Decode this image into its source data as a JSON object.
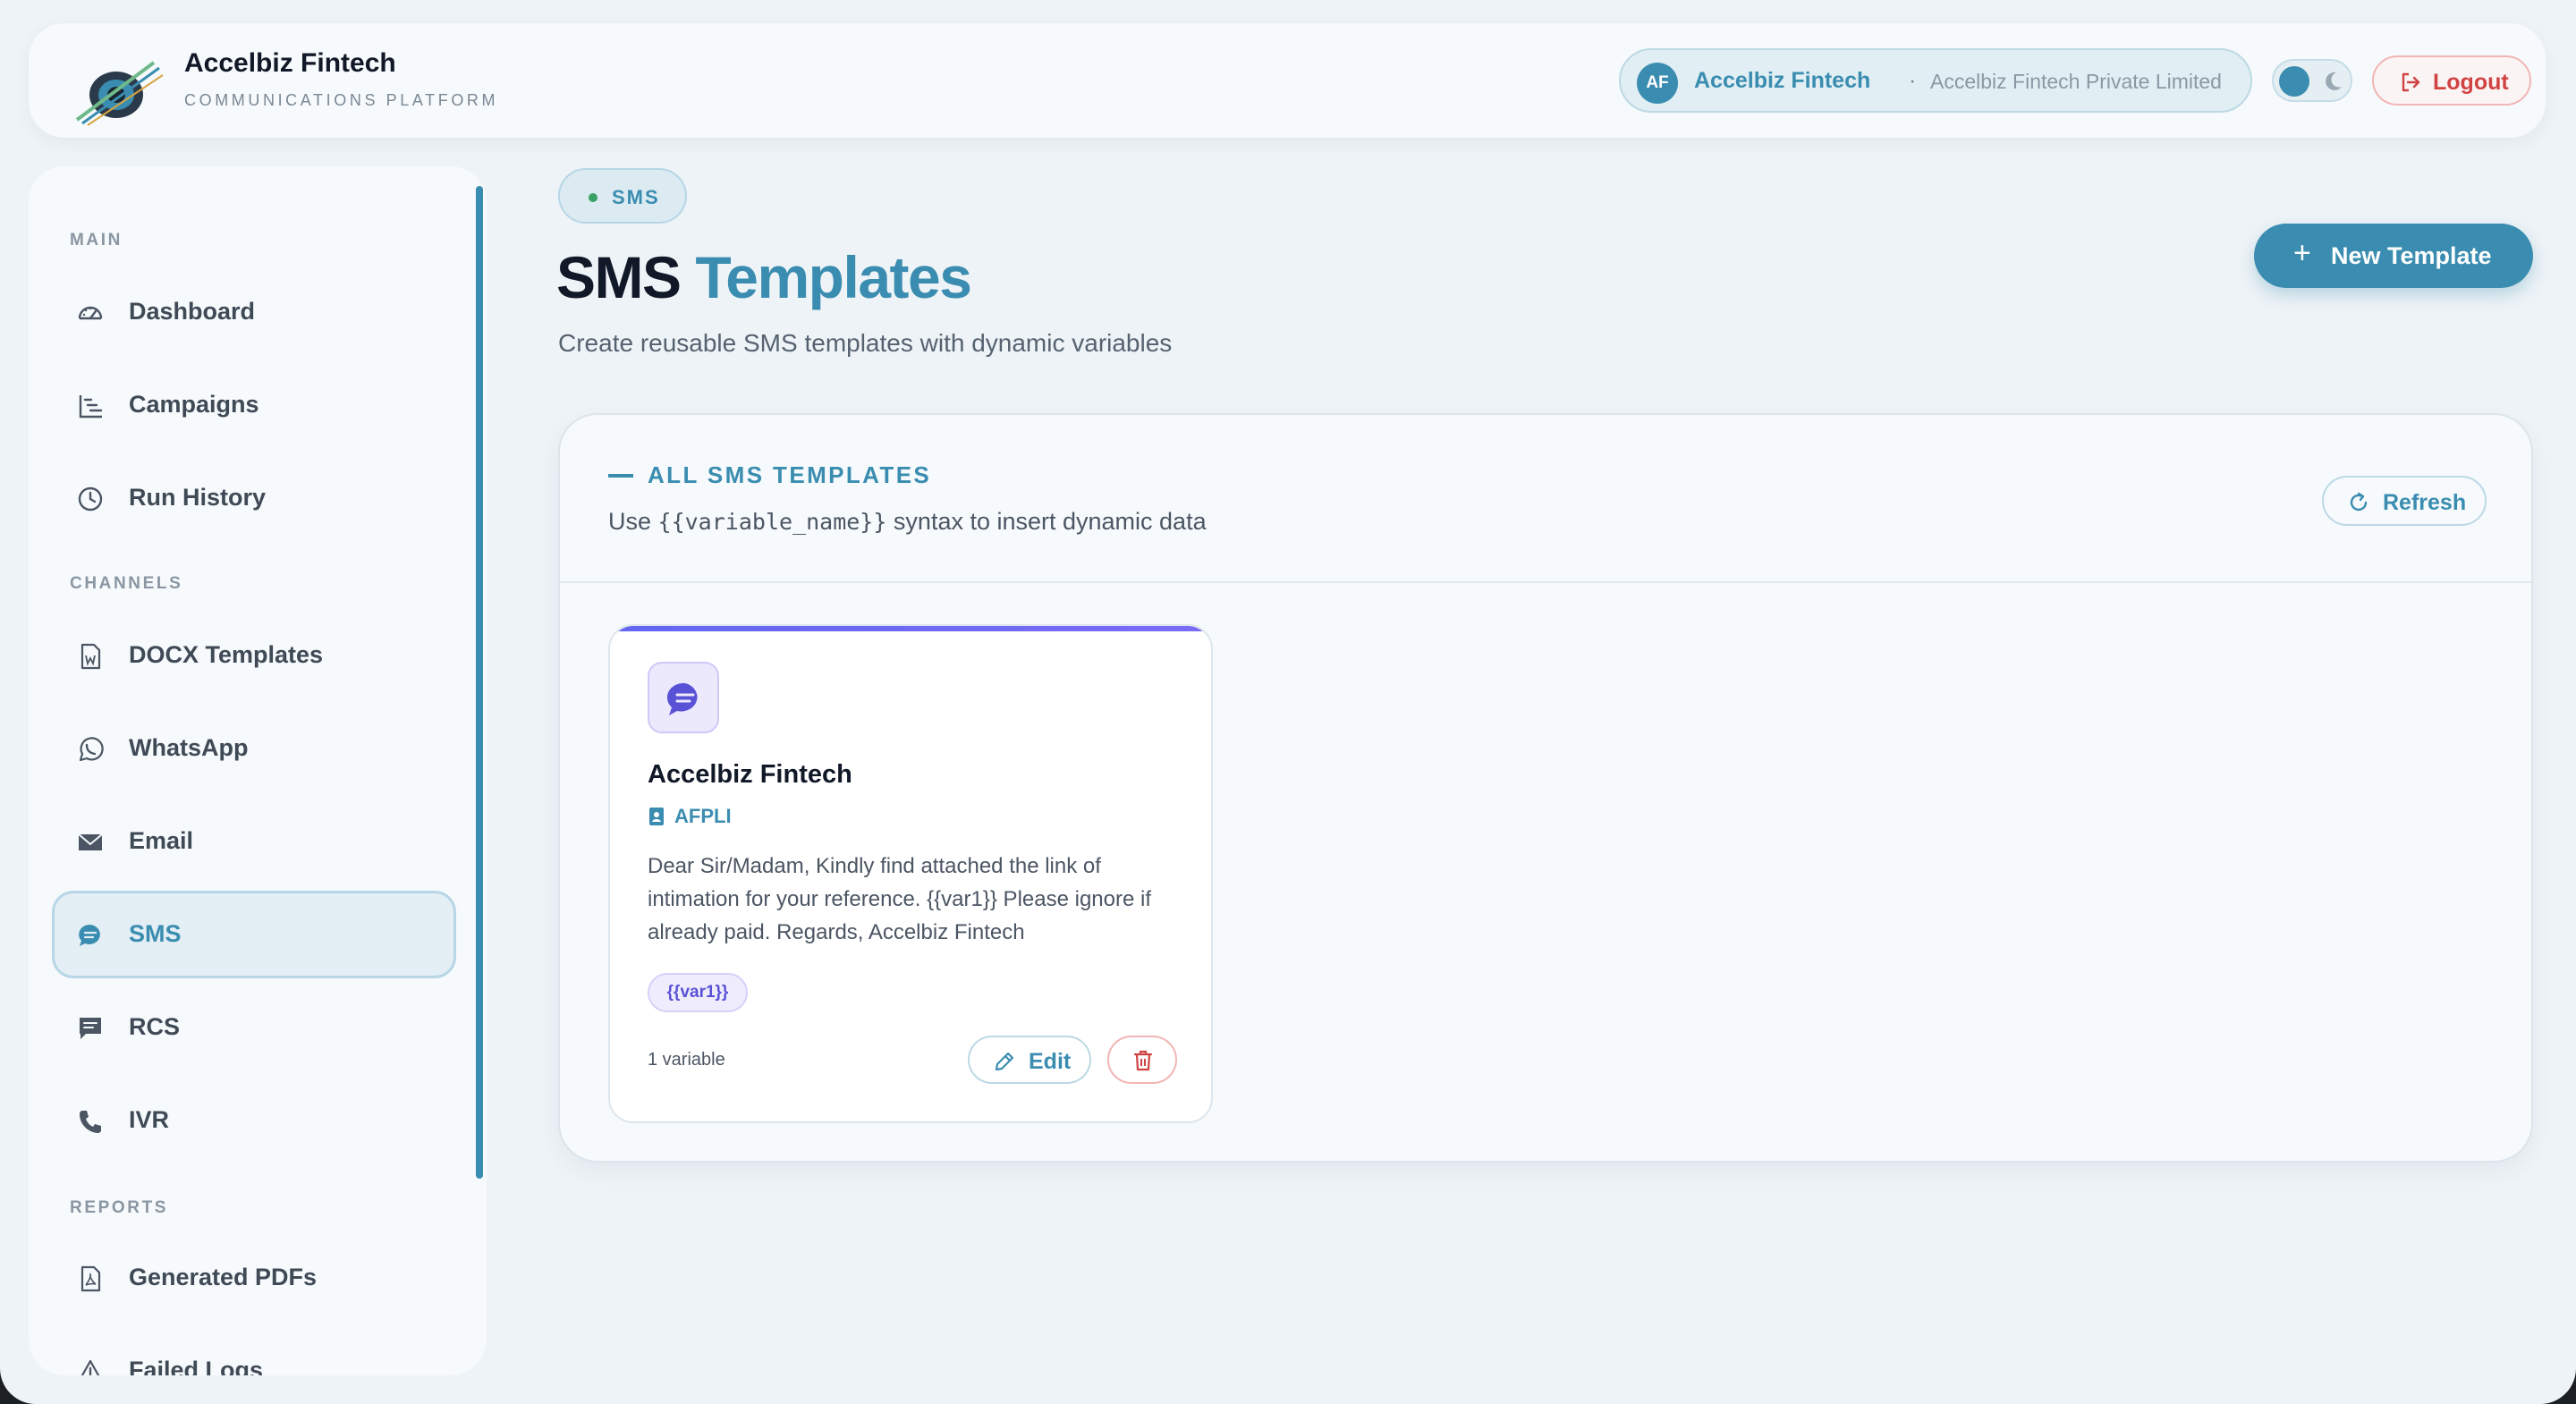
{
  "brand": {
    "name": "Accelbiz Fintech",
    "subtitle": "COMMUNICATIONS PLATFORM"
  },
  "header": {
    "org_avatar": "AF",
    "org_name": "Accelbiz Fintech",
    "org_separator": "·",
    "org_company": "Accelbiz Fintech Private Limited",
    "logout_label": "Logout"
  },
  "sidebar": {
    "sections": [
      {
        "label": "MAIN"
      },
      {
        "label": "CHANNELS"
      },
      {
        "label": "REPORTS"
      }
    ],
    "items": [
      {
        "label": "Dashboard",
        "icon": "dashboard-icon"
      },
      {
        "label": "Campaigns",
        "icon": "campaigns-icon"
      },
      {
        "label": "Run History",
        "icon": "clock-icon"
      },
      {
        "label": "DOCX Templates",
        "icon": "docx-icon"
      },
      {
        "label": "WhatsApp",
        "icon": "whatsapp-icon"
      },
      {
        "label": "Email",
        "icon": "envelope-icon"
      },
      {
        "label": "SMS",
        "icon": "sms-icon",
        "active": true
      },
      {
        "label": "RCS",
        "icon": "rcs-icon"
      },
      {
        "label": "IVR",
        "icon": "phone-icon"
      },
      {
        "label": "Generated PDFs",
        "icon": "pdf-icon"
      },
      {
        "label": "Failed Logs",
        "icon": "warning-icon"
      }
    ]
  },
  "main": {
    "crumb": "SMS",
    "title_part1": "SMS",
    "title_part2": "Templates",
    "subtitle": "Create reusable SMS templates with dynamic variables",
    "new_template_label": "New Template",
    "panel": {
      "title": "ALL SMS TEMPLATES",
      "hint_prefix": "Use",
      "hint_code": "{{variable_name}}",
      "hint_suffix": "syntax to insert dynamic data",
      "refresh_label": "Refresh"
    },
    "templates": [
      {
        "name": "Accelbiz Fintech",
        "sender": "AFPLI",
        "body": "Dear Sir/Madam, Kindly find attached the link of intimation for your reference. {{var1}} Please ignore if already paid. Regards, Accelbiz Fintech",
        "variables": [
          "{{var1}}"
        ],
        "variable_count": "1 variable",
        "edit_label": "Edit"
      }
    ]
  },
  "colors": {
    "accent": "#3a8db0",
    "danger": "#d14343",
    "purple": "#6366f1",
    "status_green": "#3aa165"
  }
}
